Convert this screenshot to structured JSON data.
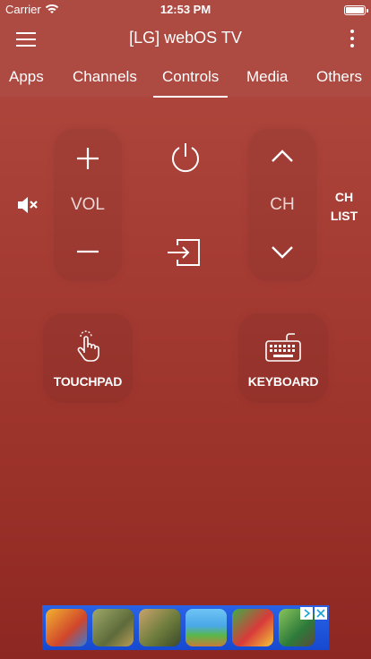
{
  "status_bar": {
    "carrier": "Carrier",
    "time": "12:53 PM"
  },
  "header": {
    "title": "[LG] webOS TV"
  },
  "tabs": [
    {
      "label": "Apps"
    },
    {
      "label": "Channels"
    },
    {
      "label": "Controls",
      "active": true
    },
    {
      "label": "Media"
    },
    {
      "label": "Others"
    }
  ],
  "controls": {
    "vol_label": "VOL",
    "ch_label": "CH",
    "ch_list_line1": "CH",
    "ch_list_line2": "LIST",
    "touchpad_label": "TOUCHPAD",
    "keyboard_label": "KEYBOARD"
  },
  "colors": {
    "background_top": "#b24a40",
    "background_bottom": "#8d2721",
    "ad_blue": "#1e56e0"
  }
}
